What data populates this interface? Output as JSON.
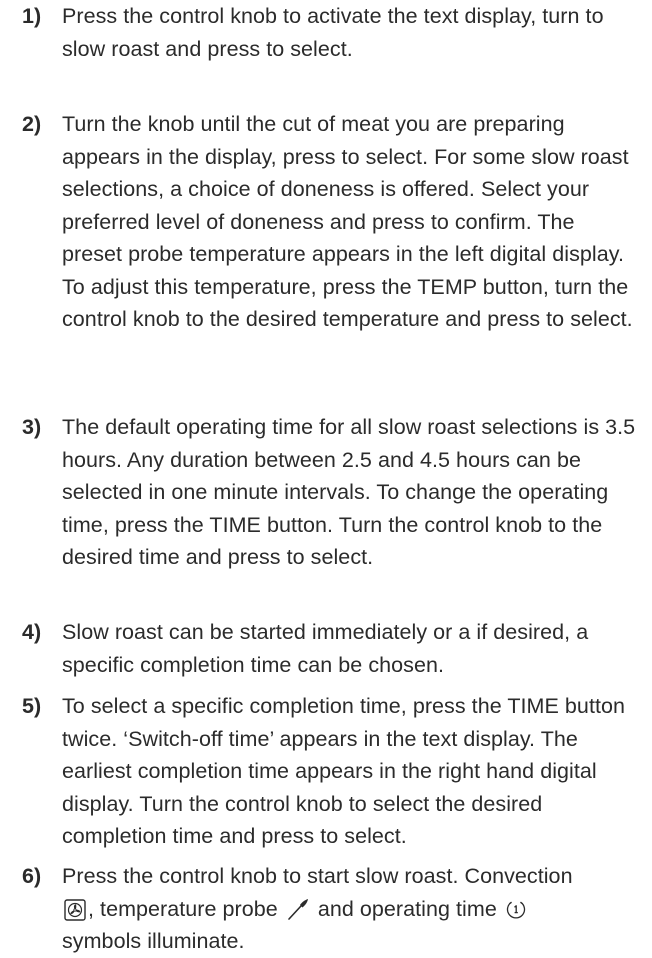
{
  "steps": [
    {
      "number": "1)",
      "text": "Press the control knob to activate the text display, turn to slow roast and press to select."
    },
    {
      "number": "2)",
      "text": "Turn the knob until the cut of meat you are preparing appears in the display, press to select. For some slow roast selections, a choice of doneness is offered. Select your preferred level of doneness and press to confirm. The preset probe temperature appears in the left digital display. To adjust this temperature, press the TEMP button, turn the control knob to the desired temperature and press to select."
    },
    {
      "number": "3)",
      "text": "The default operating time for all slow roast selections is 3.5 hours. Any duration between 2.5 and 4.5 hours can be selected in one minute intervals. To change the operating time, press the TIME button. Turn the control knob to the desired time and press to select."
    },
    {
      "number": "4)",
      "text": "Slow roast can be started immediately or a if desired, a specific completion time can be chosen."
    },
    {
      "number": "5)",
      "text": "To select a specific completion time, press the TIME button twice. ‘Switch-off time’ appears in the text display. The earliest completion time appears in the right hand digital display. Turn the control knob to select the desired completion time and press to select."
    },
    {
      "number": "6)",
      "text_part1": "Press the control knob to start slow roast. Convection",
      "text_part2": ", temperature probe",
      "text_part3": "and operating time",
      "text_part4": "symbols illuminate."
    }
  ]
}
